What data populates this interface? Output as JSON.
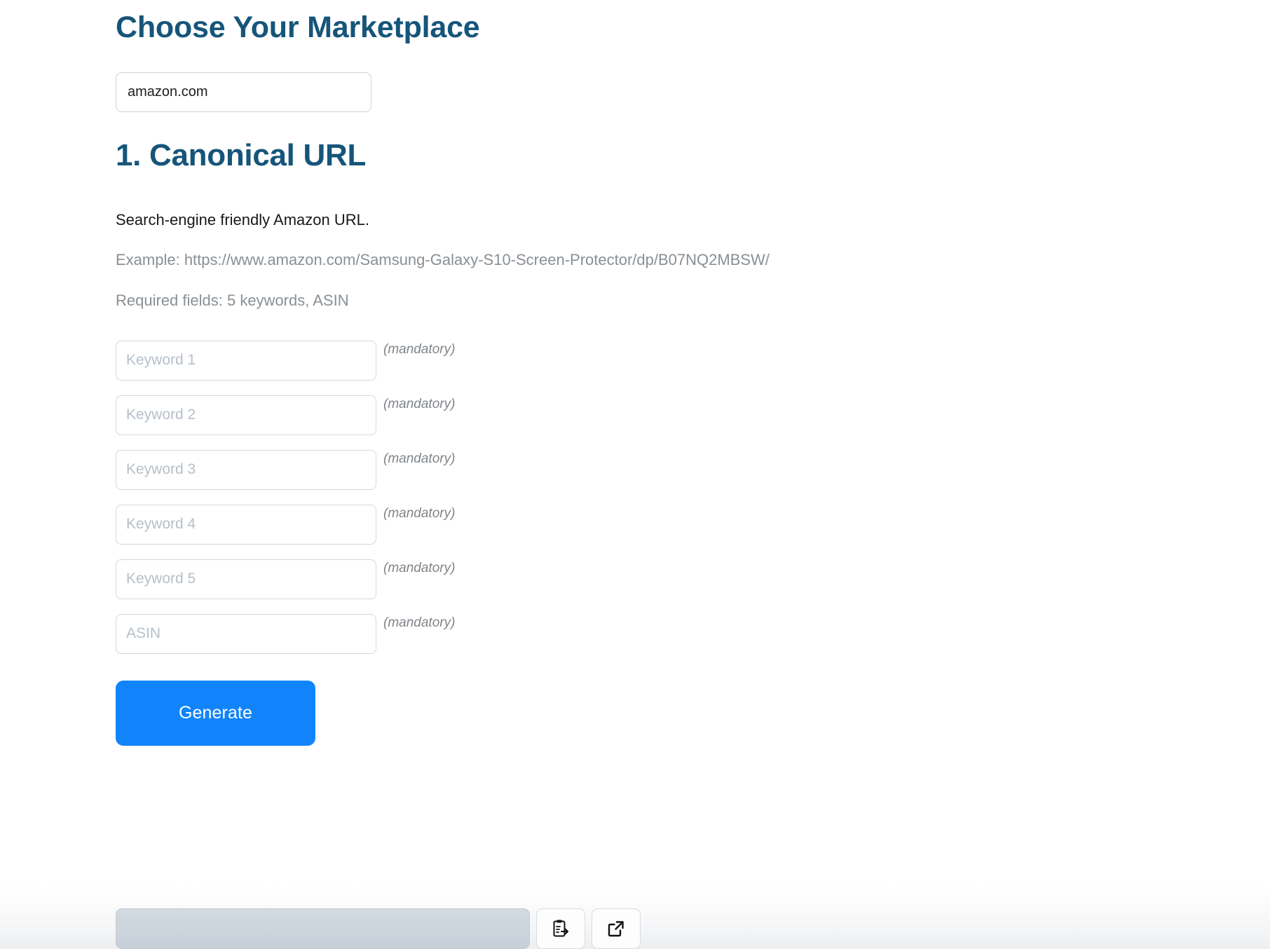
{
  "page": {
    "title": "Choose Your Marketplace",
    "accent_heading_color": "#16557a",
    "accent_button_color": "#1184fb"
  },
  "marketplace": {
    "selected": "amazon.com",
    "options": [
      "amazon.com"
    ]
  },
  "section": {
    "heading": "1. Canonical URL",
    "description": "Search-engine friendly Amazon URL.",
    "example": "Example: https://www.amazon.com/Samsung-Galaxy-S10-Screen-Protector/dp/B07NQ2MBSW/",
    "required_fields": "Required fields: 5 keywords, ASIN"
  },
  "form": {
    "fields": [
      {
        "placeholder": "Keyword 1",
        "value": "",
        "note": "(mandatory)"
      },
      {
        "placeholder": "Keyword 2",
        "value": "",
        "note": "(mandatory)"
      },
      {
        "placeholder": "Keyword 3",
        "value": "",
        "note": "(mandatory)"
      },
      {
        "placeholder": "Keyword 4",
        "value": "",
        "note": "(mandatory)"
      },
      {
        "placeholder": "Keyword 5",
        "value": "",
        "note": "(mandatory)"
      },
      {
        "placeholder": "ASIN",
        "value": "",
        "note": "(mandatory)"
      }
    ],
    "generate_label": "Generate"
  },
  "output": {
    "value": "",
    "placeholder": "",
    "copy_icon": "clipboard-paste-icon",
    "open_icon": "external-link-icon"
  }
}
